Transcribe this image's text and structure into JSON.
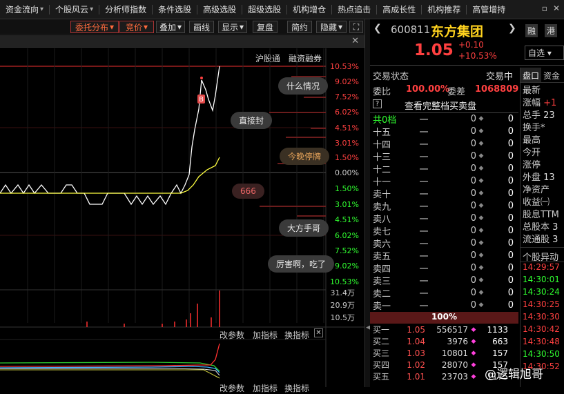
{
  "menu": [
    {
      "label": "资金流向",
      "arrow": "▾"
    },
    {
      "label": "个股风云",
      "arrow": "▾"
    },
    {
      "label": "分析师指数",
      "arrow": ""
    },
    {
      "label": "条件选股",
      "arrow": ""
    },
    {
      "label": "高级选股",
      "arrow": ""
    },
    {
      "label": "超级选股",
      "arrow": ""
    },
    {
      "label": "机构增仓",
      "arrow": ""
    },
    {
      "label": "热点追击",
      "arrow": ""
    },
    {
      "label": "高成长性",
      "arrow": ""
    },
    {
      "label": "机构推荐",
      "arrow": ""
    },
    {
      "label": "高管增持",
      "arrow": ""
    }
  ],
  "toolbar": {
    "weituo": "委托分布",
    "jingjia": "竞价",
    "diejia": "叠加",
    "huaxian": "画线",
    "xianshi": "显示",
    "fupan": "复盘",
    "jianyue": "简约",
    "yincang": "隐藏"
  },
  "tabs": {
    "hgt": "沪股通",
    "rzrq": "融资融券"
  },
  "pct_up": [
    "10.53%",
    "9.02%",
    "7.52%",
    "6.02%",
    "4.51%",
    "3.01%",
    "1.50%",
    "0.00%"
  ],
  "pct_down": [
    "1.50%",
    "3.01%",
    "4.51%",
    "6.02%",
    "7.52%",
    "9.02%",
    "10.53%"
  ],
  "bubbles": [
    "什么情况",
    "直接封",
    "今晚停牌",
    "666",
    "大方手哥",
    "厉害啊，吃了"
  ],
  "vol_labels": [
    "31.4万",
    "20.9万",
    "10.5万"
  ],
  "ind_bar": {
    "p1": "改参数",
    "p2": "加指标",
    "p3": "换指标"
  },
  "ind_bar2": {
    "p1": "改参数",
    "p2": "加指标",
    "p3": "换指标"
  },
  "marker": "B",
  "stock": {
    "code": "600811",
    "name": "东方集团",
    "price": "1.05",
    "chg": "+0.10",
    "chgpct": "+10.53%",
    "rong": "融",
    "gang": "港",
    "zixuan": "自选"
  },
  "state": {
    "label": "交易状态",
    "value": "交易中",
    "weibi_l": "委比",
    "weibi": "100.00%",
    "weicha_l": "委差",
    "weicha": "1068809",
    "view_full": "查看完整档买卖盘",
    "q": "?"
  },
  "sell_header": {
    "label": "共0档",
    "price": "一",
    "vol": "0",
    "pv": "0"
  },
  "sell_rows": [
    {
      "label": "十五"
    },
    {
      "label": "十四"
    },
    {
      "label": "十三"
    },
    {
      "label": "十二"
    },
    {
      "label": "十一"
    },
    {
      "label": "卖十"
    },
    {
      "label": "卖九"
    },
    {
      "label": "卖八"
    },
    {
      "label": "卖七"
    },
    {
      "label": "卖六"
    },
    {
      "label": "卖五"
    },
    {
      "label": "卖四"
    },
    {
      "label": "卖三"
    },
    {
      "label": "卖二"
    },
    {
      "label": "卖一"
    }
  ],
  "sell_cell": {
    "price": "一",
    "vol": "0",
    "pv": "0"
  },
  "ratio": "100%",
  "buy_rows": [
    {
      "label": "买一",
      "price": "1.05",
      "vol": "556517",
      "pv": "1133"
    },
    {
      "label": "买二",
      "price": "1.04",
      "vol": "3976",
      "pv": "663"
    },
    {
      "label": "买三",
      "price": "1.03",
      "vol": "10801",
      "pv": "157"
    },
    {
      "label": "买四",
      "price": "1.02",
      "vol": "28070",
      "pv": "157"
    },
    {
      "label": "买五",
      "price": "1.01",
      "vol": "23703",
      "pv": "1175"
    }
  ],
  "side_tabs": {
    "pankou": "盘口",
    "zijin": "资金"
  },
  "side_rows": [
    {
      "l": "最新",
      "v": ""
    },
    {
      "l": "涨幅",
      "v": "+1"
    },
    {
      "l": "总手",
      "v": "23"
    },
    {
      "l": "换手*",
      "v": ""
    },
    {
      "l": "最高",
      "v": ""
    },
    {
      "l": "今开",
      "v": ""
    },
    {
      "l": "涨停",
      "v": ""
    },
    {
      "l": "外盘",
      "v": "13"
    },
    {
      "l": "净资产",
      "v": ""
    },
    {
      "l": "收益㈠",
      "v": ""
    },
    {
      "l": "股息TTM",
      "v": ""
    },
    {
      "l": "总股本",
      "v": "3"
    },
    {
      "l": "流通股",
      "v": "3"
    }
  ],
  "yidong": "个股异动",
  "times": [
    {
      "t": "14:29:57",
      "c": "#ff4040"
    },
    {
      "t": "14:30:01",
      "c": "#30ff30"
    },
    {
      "t": "14:30:24",
      "c": "#30ff30"
    },
    {
      "t": "14:30:25",
      "c": "#ff4040"
    },
    {
      "t": "14:30:30",
      "c": "#ff4040"
    },
    {
      "t": "14:30:42",
      "c": "#ff4040"
    },
    {
      "t": "14:30:48",
      "c": "#ff4040"
    },
    {
      "t": "14:30:50",
      "c": "#30ff30"
    },
    {
      "t": "14:30:52",
      "c": "#ff4040"
    }
  ],
  "watermark": "@逻辑旭哥",
  "colors": {
    "up": "#ff4040",
    "down": "#30ff30",
    "price_line": "#ffffff",
    "avg_line": "#ffff40"
  }
}
